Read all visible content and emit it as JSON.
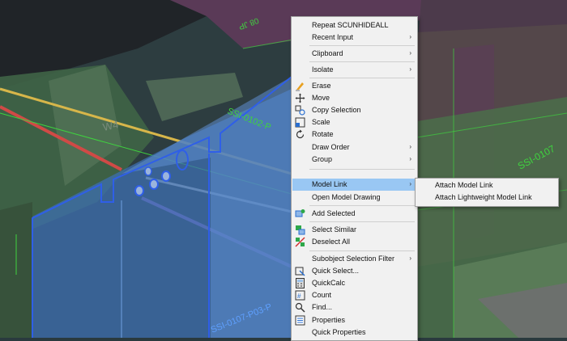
{
  "context_menu": {
    "items": [
      {
        "label": "Repeat SCUNHIDEALL",
        "icon": "",
        "submenu": false
      },
      {
        "label": "Recent Input",
        "icon": "",
        "submenu": true
      },
      {
        "label": "Clipboard",
        "icon": "",
        "submenu": true
      },
      {
        "label": "Isolate",
        "icon": "",
        "submenu": true
      },
      {
        "label": "Erase",
        "icon": "erase-icon",
        "submenu": false
      },
      {
        "label": "Move",
        "icon": "move-icon",
        "submenu": false
      },
      {
        "label": "Copy Selection",
        "icon": "copy-icon",
        "submenu": false
      },
      {
        "label": "Scale",
        "icon": "scale-icon",
        "submenu": false
      },
      {
        "label": "Rotate",
        "icon": "rotate-icon",
        "submenu": false
      },
      {
        "label": "Draw Order",
        "icon": "",
        "submenu": true
      },
      {
        "label": "Group",
        "icon": "",
        "submenu": true
      },
      {
        "label": "Model Link",
        "icon": "",
        "submenu": true
      },
      {
        "label": "Open Model Drawing",
        "icon": "",
        "submenu": false
      },
      {
        "label": "Add Selected",
        "icon": "add-selected-icon",
        "submenu": false
      },
      {
        "label": "Select Similar",
        "icon": "select-similar-icon",
        "submenu": false
      },
      {
        "label": "Deselect All",
        "icon": "deselect-all-icon",
        "submenu": false
      },
      {
        "label": "Subobject Selection Filter",
        "icon": "",
        "submenu": true
      },
      {
        "label": "Quick Select...",
        "icon": "quick-select-icon",
        "submenu": false
      },
      {
        "label": "QuickCalc",
        "icon": "calculator-icon",
        "submenu": false
      },
      {
        "label": "Count",
        "icon": "count-icon",
        "submenu": false
      },
      {
        "label": "Find...",
        "icon": "find-icon",
        "submenu": false
      },
      {
        "label": "Properties",
        "icon": "properties-icon",
        "submenu": false
      },
      {
        "label": "Quick Properties",
        "icon": "",
        "submenu": false
      }
    ],
    "highlighted": "Model Link",
    "submenu_arrow": "›"
  },
  "model_link_submenu": {
    "items": [
      {
        "label": "Attach Model Link"
      },
      {
        "label": "Attach Lightweight Model Link"
      }
    ]
  },
  "drawing": {
    "labels": {
      "w4": "W4",
      "ssi_0102": "SSI-0102-P",
      "ssi_0107_right": "SSI-0107",
      "ssi_0107_bottom": "SSI-0107-P03-P",
      "top_mark": "08 JP"
    }
  },
  "colors": {
    "menu_bg": "#f1f1f1",
    "highlight": "#99c7f3",
    "selection_blue": "#2f5fe8",
    "label_green": "#3fd23f"
  }
}
